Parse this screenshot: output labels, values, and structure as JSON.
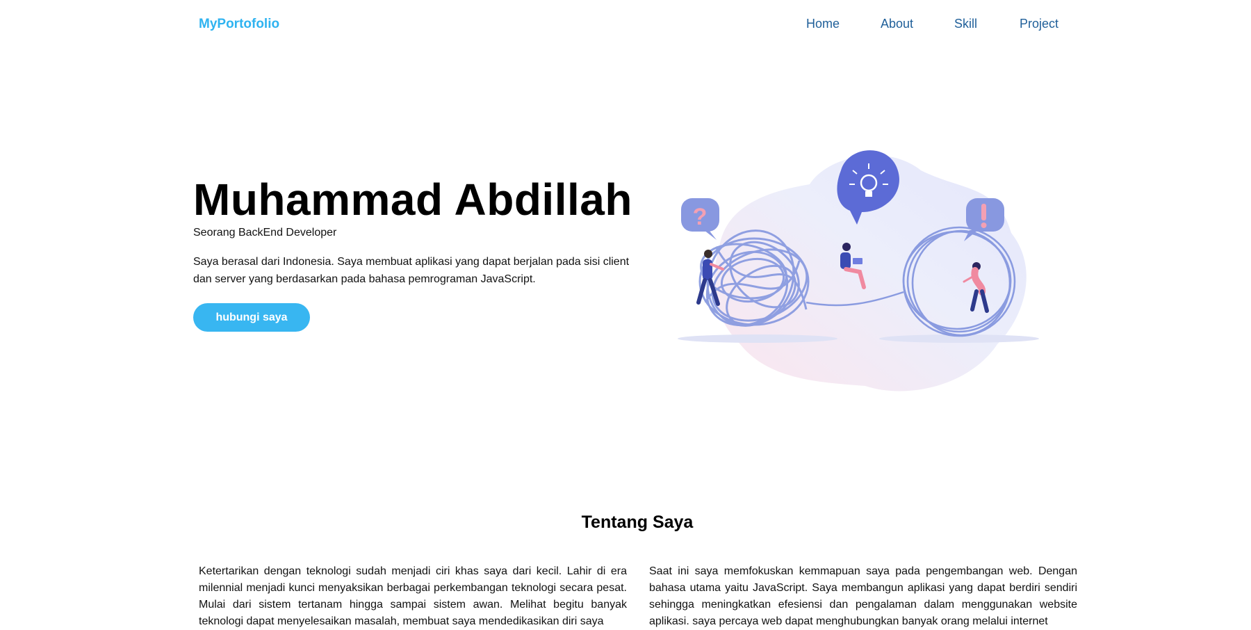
{
  "nav": {
    "brand": "MyPortofolio",
    "links": [
      {
        "label": "Home"
      },
      {
        "label": "About"
      },
      {
        "label": "Skill"
      },
      {
        "label": "Project"
      }
    ]
  },
  "hero": {
    "name": "Muhammad Abdillah",
    "role": "Seorang BackEnd Developer",
    "description": "Saya berasal dari Indonesia. Saya membuat aplikasi yang dapat berjalan pada sisi client dan server yang berdasarkan pada bahasa pemrograman JavaScript.",
    "cta_label": "hubungi saya"
  },
  "about": {
    "title": "Tentang Saya",
    "paragraph_left": "Ketertarikan dengan teknologi sudah menjadi ciri khas saya dari kecil. Lahir di era milennial menjadi kunci menyaksikan berbagai perkembangan teknologi secara pesat. Mulai dari sistem tertanam hingga sampai sistem awan. Melihat begitu banyak teknologi dapat menyelesaikan masalah, membuat saya mendedikasikan diri saya",
    "paragraph_right": "Saat ini saya memfokuskan kemmapuan saya pada pengembangan web. Dengan bahasa utama yaitu JavaScript. Saya membangun aplikasi yang dapat berdiri sendiri sehingga meningkatkan efesiensi dan pengalaman dalam menggunakan website aplikasi. saya percaya web dapat menghubungkan banyak orang melalui internet"
  },
  "colors": {
    "brand": "#2fb3f0",
    "nav_link": "#1f5f99",
    "cta": "#38b6f1",
    "illustration_blob": "#e6e8fb",
    "illustration_accent": "#5c6bd6",
    "illustration_pink": "#f08aa0"
  }
}
